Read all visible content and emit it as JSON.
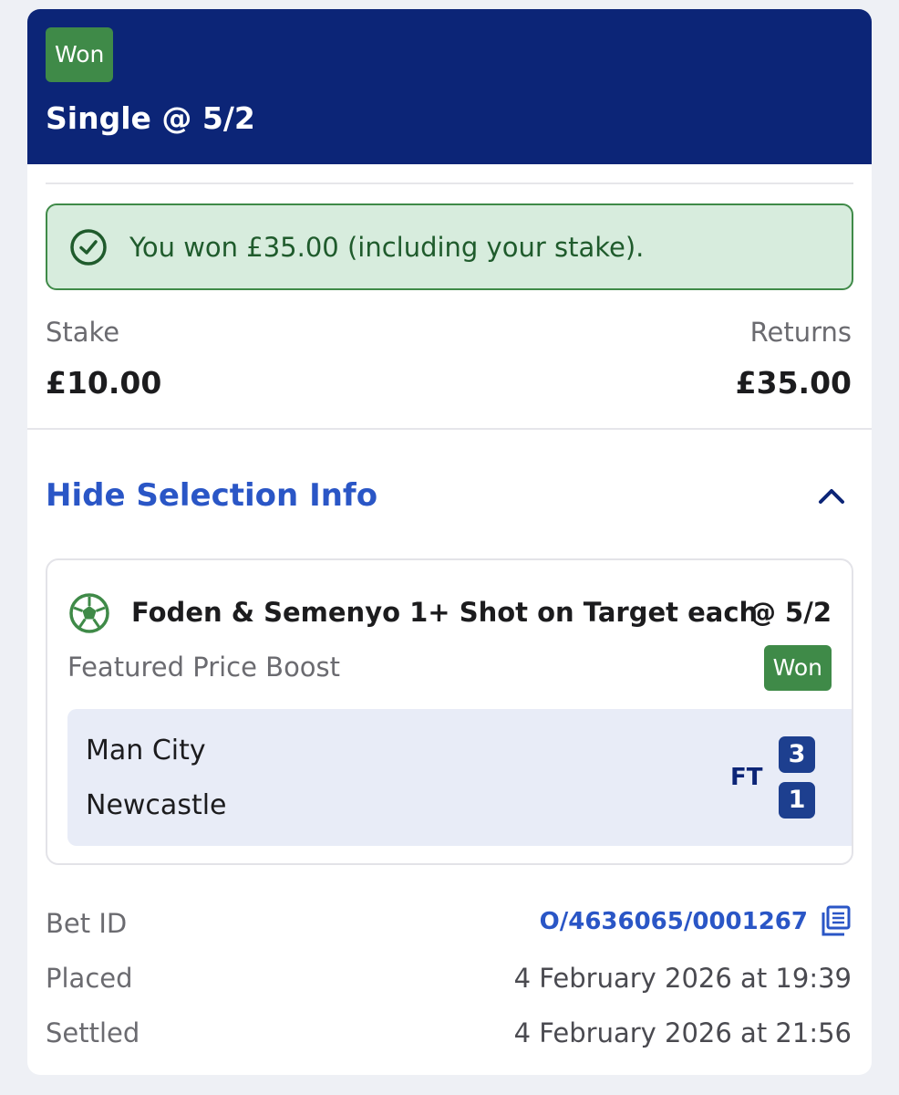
{
  "header": {
    "status": "Won",
    "title": "Single @ 5/2"
  },
  "banner": {
    "message": "You won £35.00 (including your stake).",
    "icon": "check-circle-icon"
  },
  "summary": {
    "stake_label": "Stake",
    "stake_value": "£10.00",
    "returns_label": "Returns",
    "returns_value": "£35.00"
  },
  "selection_toggle": {
    "label": "Hide Selection Info",
    "icon": "chevron-up-icon"
  },
  "selection": {
    "icon": "football-icon",
    "name": "Foden & Semenyo 1+ Shot on Target each",
    "odds": "@ 5/2",
    "market": "Featured Price Boost",
    "status": "Won",
    "match": {
      "home_team": "Man City",
      "away_team": "Newcastle",
      "state": "FT",
      "home_score": "3",
      "away_score": "1"
    }
  },
  "details": {
    "bet_id_label": "Bet ID",
    "bet_id_value": "O/4636065/0001267",
    "placed_label": "Placed",
    "placed_value": "4 February 2026 at 19:39",
    "settled_label": "Settled",
    "settled_value": "4 February 2026 at 21:56"
  },
  "colors": {
    "header_bg": "#0c2577",
    "won_green": "#3f8a48",
    "banner_bg": "#d7ecdd",
    "link_blue": "#2a56c6",
    "score_bg": "#1d3f8f"
  }
}
